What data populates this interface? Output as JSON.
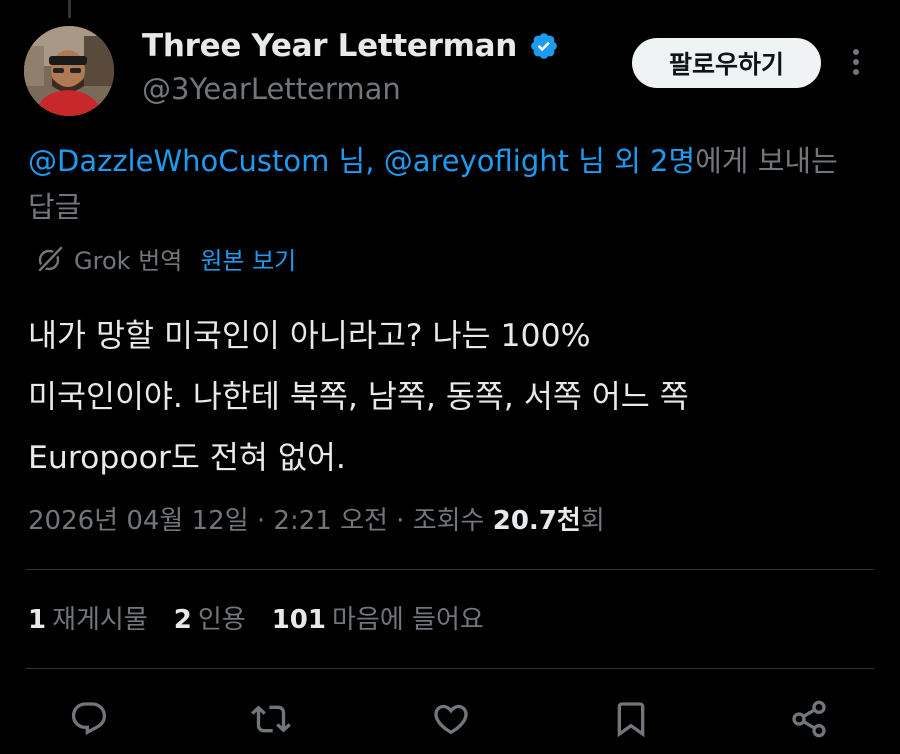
{
  "author": {
    "display_name": "Three Year Letterman",
    "handle": "@3YearLetterman",
    "verified": true
  },
  "follow_button": {
    "label": "팔로우하기"
  },
  "replying_to": {
    "mention1": "@DazzleWhoCustom 님,",
    "mention2": "@areyoflight 님 외 2명",
    "suffix": "에게 보내는",
    "line2": "답글"
  },
  "translation": {
    "label": "Grok 번역",
    "show_original": "원본 보기"
  },
  "tweet": {
    "lines": [
      "내가 망할 미국인이 아니라고? 나는 100%",
      "미국인이야. 나한테 북쪽, 남쪽, 동쪽, 서쪽 어느 쪽",
      "Europoor도 전혀 없어."
    ]
  },
  "meta": {
    "timestamp": "2026년 04월 12일 · 2:21 오전 · 조회수 ",
    "views_number": "20.7천",
    "views_suffix": "회"
  },
  "stats": {
    "reposts_count": "1",
    "reposts_label": "재게시물",
    "quotes_count": "2",
    "quotes_label": "인용",
    "likes_count": "101",
    "likes_label": "마음에 들어요"
  },
  "icons": {
    "more": "more-vertical-icon",
    "reply": "reply-icon",
    "repost": "repost-icon",
    "like": "heart-icon",
    "bookmark": "bookmark-icon",
    "share": "share-icon",
    "grok": "grok-icon",
    "verified": "verified-badge-icon"
  },
  "colors": {
    "background": "#000000",
    "text_primary": "#e7e9ea",
    "text_secondary": "#71767b",
    "accent_blue": "#1d9bf0",
    "divider": "#2f3336"
  }
}
